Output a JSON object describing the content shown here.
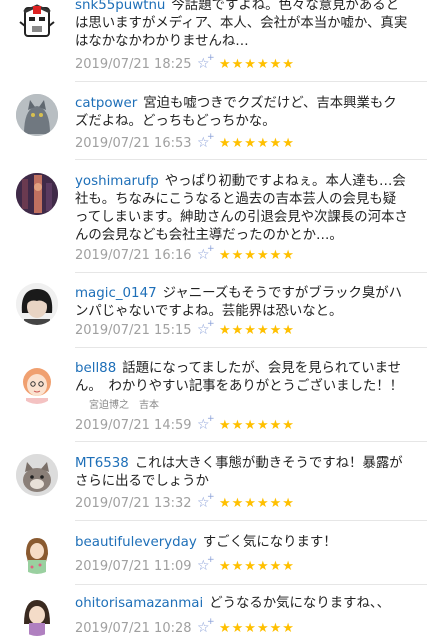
{
  "comments": [
    {
      "user": "snk55puwtnu",
      "text": "今話題ですよね。色々な意見があるとは思いますがメディア、本人、会社が本当か嘘か、真実はなかなかわかりませんね…",
      "date": "2019/07/21 18:25",
      "stars": "★★★★★★"
    },
    {
      "user": "catpower",
      "text": "宮迫も嘘つきでクズだけど、吉本興業もクズだよね。どっちもどっちかな。",
      "date": "2019/07/21 16:53",
      "stars": "★★★★★★"
    },
    {
      "user": "yoshimarufp",
      "text": "やっぱり初動ですよねぇ。本人達も…会社も。ちなみにこうなると過去の吉本芸人の会見も疑ってしまいます。紳助さんの引退会見や次課長の河本さんの会見なども会社主導だったのかとか…。",
      "date": "2019/07/21 16:16",
      "stars": "★★★★★★"
    },
    {
      "user": "magic_0147",
      "text": "ジャニーズもそうですがブラック臭がハンパじゃないですよね。芸能界は恐いなと。",
      "date": "2019/07/21 15:15",
      "stars": "★★★★★★"
    },
    {
      "user": "bell88",
      "text": "話題になってましたが、会見を見られていません。　わかりやすい記事をありがとうございました！！",
      "tags": "宮迫博之　吉本",
      "date": "2019/07/21 14:59",
      "stars": "★★★★★★"
    },
    {
      "user": "MT6538",
      "text": "これは大きく事態が動きそうですね！暴露がさらに出るでしょうか",
      "date": "2019/07/21 13:32",
      "stars": "★★★★★★"
    },
    {
      "user": "beautifuleveryday",
      "text": "すごく気になります！",
      "date": "2019/07/21 11:09",
      "stars": "★★★★★★"
    },
    {
      "user": "ohitorisamazanmai",
      "text": "どうなるか気になりますね、、",
      "date": "2019/07/21 10:28",
      "stars": "★★★★★★"
    }
  ],
  "icons": {
    "favorite": "star-outline-plus-icon",
    "rating": "star-icon"
  },
  "colors": {
    "username": "#1e6fb8",
    "date": "#a0a0a0",
    "star": "#ffc000",
    "favorite": "#8aa0d8"
  }
}
